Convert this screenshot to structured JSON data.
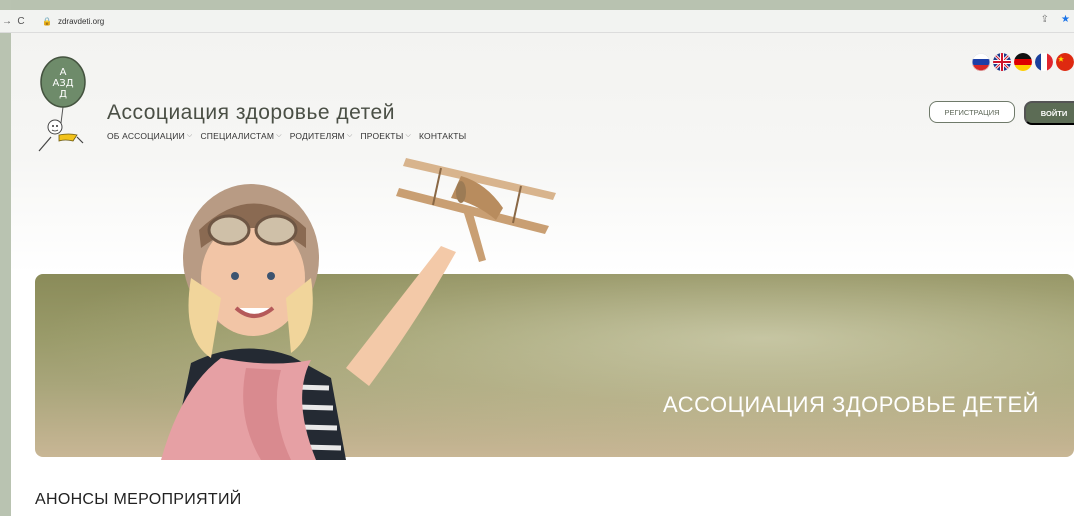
{
  "browser": {
    "url": "zdravdeti.org",
    "back_icon": "back-icon",
    "reload_icon": "reload-icon"
  },
  "header": {
    "logo_letters": [
      "А",
      "АЗД",
      "Д"
    ],
    "site_title": "Ассоциация здоровье детей",
    "nav": [
      {
        "label": "ОБ АССОЦИАЦИИ",
        "has_dropdown": true
      },
      {
        "label": "СПЕЦИАЛИСТАМ",
        "has_dropdown": true
      },
      {
        "label": "РОДИТЕЛЯМ",
        "has_dropdown": true
      },
      {
        "label": "ПРОЕКТЫ",
        "has_dropdown": true
      },
      {
        "label": "КОНТАКТЫ",
        "has_dropdown": false
      }
    ],
    "register_label": "РЕГИСТРАЦИЯ",
    "login_label": "ВОЙТИ",
    "languages": [
      "ru",
      "en",
      "de",
      "fr",
      "zh"
    ]
  },
  "hero": {
    "title": "АССОЦИАЦИЯ ЗДОРОВЬЕ ДЕТЕЙ"
  },
  "sections": {
    "announcements_title": "АНОНСЫ МЕРОПРИЯТИЙ"
  },
  "colors": {
    "accent": "#5c6c55",
    "hero_bg": "#9a9b6a"
  }
}
